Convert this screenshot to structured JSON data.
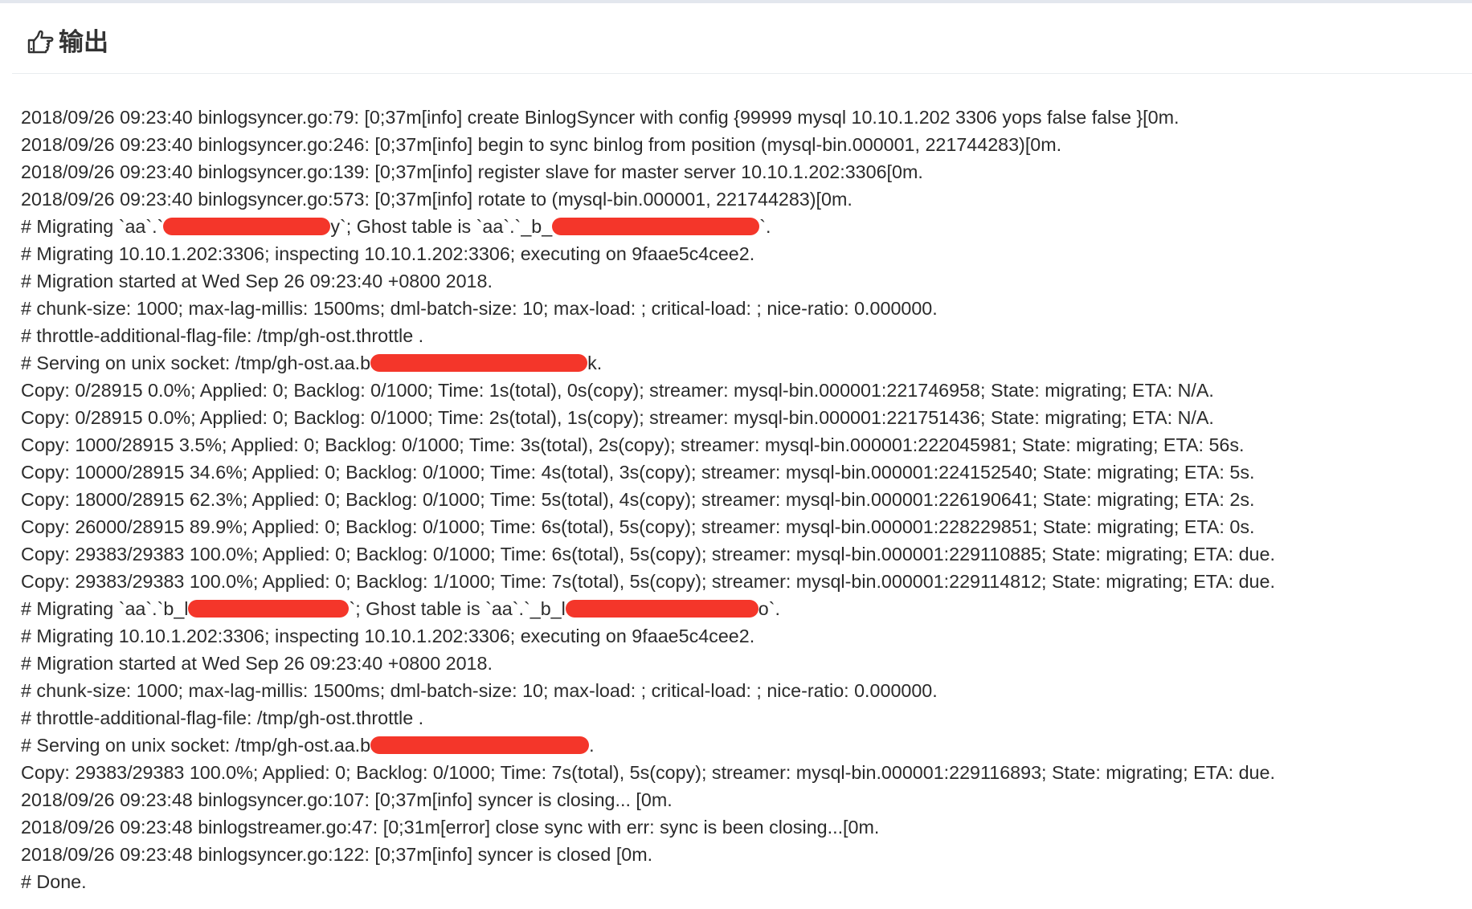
{
  "header": {
    "title": "输出",
    "icon": "hand-pointing-right-icon"
  },
  "colors": {
    "redaction": "#f4362a",
    "text": "#2b2b2b",
    "top_bar": "#e3e7ee"
  },
  "log": {
    "lines": [
      {
        "text": "2018/09/26 09:23:40 binlogsyncer.go:79: [0;37m[info] create BinlogSyncer with config {99999 mysql 10.10.1.202 3306 yops false false }[0m."
      },
      {
        "text": "2018/09/26 09:23:40 binlogsyncer.go:246: [0;37m[info] begin to sync binlog from position (mysql-bin.000001, 221744283)[0m."
      },
      {
        "text": "2018/09/26 09:23:40 binlogsyncer.go:139: [0;37m[info] register slave for master server 10.10.1.202:3306[0m."
      },
      {
        "text": "2018/09/26 09:23:40 binlogsyncer.go:573: [0;37m[info] rotate to (mysql-bin.000001, 221744283)[0m."
      },
      {
        "segments": [
          "# Migrating `aa`.`",
          "",
          "y`; Ghost table is `aa`.`_b_",
          "",
          "`."
        ],
        "redacted": true
      },
      {
        "text": "# Migrating 10.10.1.202:3306; inspecting 10.10.1.202:3306; executing on 9faae5c4cee2."
      },
      {
        "text": "# Migration started at Wed Sep 26 09:23:40 +0800 2018."
      },
      {
        "text": "# chunk-size: 1000; max-lag-millis: 1500ms; dml-batch-size: 10; max-load: ; critical-load: ; nice-ratio: 0.000000."
      },
      {
        "text": "# throttle-additional-flag-file: /tmp/gh-ost.throttle ."
      },
      {
        "segments": [
          "# Serving on unix socket: /tmp/gh-ost.aa.b",
          "",
          "k."
        ],
        "redacted": true
      },
      {
        "text": "Copy: 0/28915 0.0%; Applied: 0; Backlog: 0/1000; Time: 1s(total), 0s(copy); streamer: mysql-bin.000001:221746958; State: migrating; ETA: N/A."
      },
      {
        "text": "Copy: 0/28915 0.0%; Applied: 0; Backlog: 0/1000; Time: 2s(total), 1s(copy); streamer: mysql-bin.000001:221751436; State: migrating; ETA: N/A."
      },
      {
        "text": "Copy: 1000/28915 3.5%; Applied: 0; Backlog: 0/1000; Time: 3s(total), 2s(copy); streamer: mysql-bin.000001:222045981; State: migrating; ETA: 56s."
      },
      {
        "text": "Copy: 10000/28915 34.6%; Applied: 0; Backlog: 0/1000; Time: 4s(total), 3s(copy); streamer: mysql-bin.000001:224152540; State: migrating; ETA: 5s."
      },
      {
        "text": "Copy: 18000/28915 62.3%; Applied: 0; Backlog: 0/1000; Time: 5s(total), 4s(copy); streamer: mysql-bin.000001:226190641; State: migrating; ETA: 2s."
      },
      {
        "text": "Copy: 26000/28915 89.9%; Applied: 0; Backlog: 0/1000; Time: 6s(total), 5s(copy); streamer: mysql-bin.000001:228229851; State: migrating; ETA: 0s."
      },
      {
        "text": "Copy: 29383/29383 100.0%; Applied: 0; Backlog: 0/1000; Time: 6s(total), 5s(copy); streamer: mysql-bin.000001:229110885; State: migrating; ETA: due."
      },
      {
        "text": "Copy: 29383/29383 100.0%; Applied: 0; Backlog: 1/1000; Time: 7s(total), 5s(copy); streamer: mysql-bin.000001:229114812; State: migrating; ETA: due."
      },
      {
        "segments": [
          "# Migrating `aa`.`b_l",
          "",
          "`; Ghost table is `aa`.`_b_l",
          "",
          "o`."
        ],
        "redacted": true
      },
      {
        "text": "# Migrating 10.10.1.202:3306; inspecting 10.10.1.202:3306; executing on 9faae5c4cee2."
      },
      {
        "text": "# Migration started at Wed Sep 26 09:23:40 +0800 2018."
      },
      {
        "text": "# chunk-size: 1000; max-lag-millis: 1500ms; dml-batch-size: 10; max-load: ; critical-load: ; nice-ratio: 0.000000."
      },
      {
        "text": "# throttle-additional-flag-file: /tmp/gh-ost.throttle ."
      },
      {
        "segments": [
          "# Serving on unix socket: /tmp/gh-ost.aa.b",
          "",
          "."
        ],
        "redacted": true
      },
      {
        "text": "Copy: 29383/29383 100.0%; Applied: 0; Backlog: 0/1000; Time: 7s(total), 5s(copy); streamer: mysql-bin.000001:229116893; State: migrating; ETA: due."
      },
      {
        "text": "2018/09/26 09:23:48 binlogsyncer.go:107: [0;37m[info] syncer is closing... [0m."
      },
      {
        "text": "2018/09/26 09:23:48 binlogstreamer.go:47: [0;31m[error] close sync with err: sync is been closing...[0m."
      },
      {
        "text": "2018/09/26 09:23:48 binlogsyncer.go:122: [0;37m[info] syncer is closed [0m."
      },
      {
        "text": "# Done."
      }
    ]
  }
}
